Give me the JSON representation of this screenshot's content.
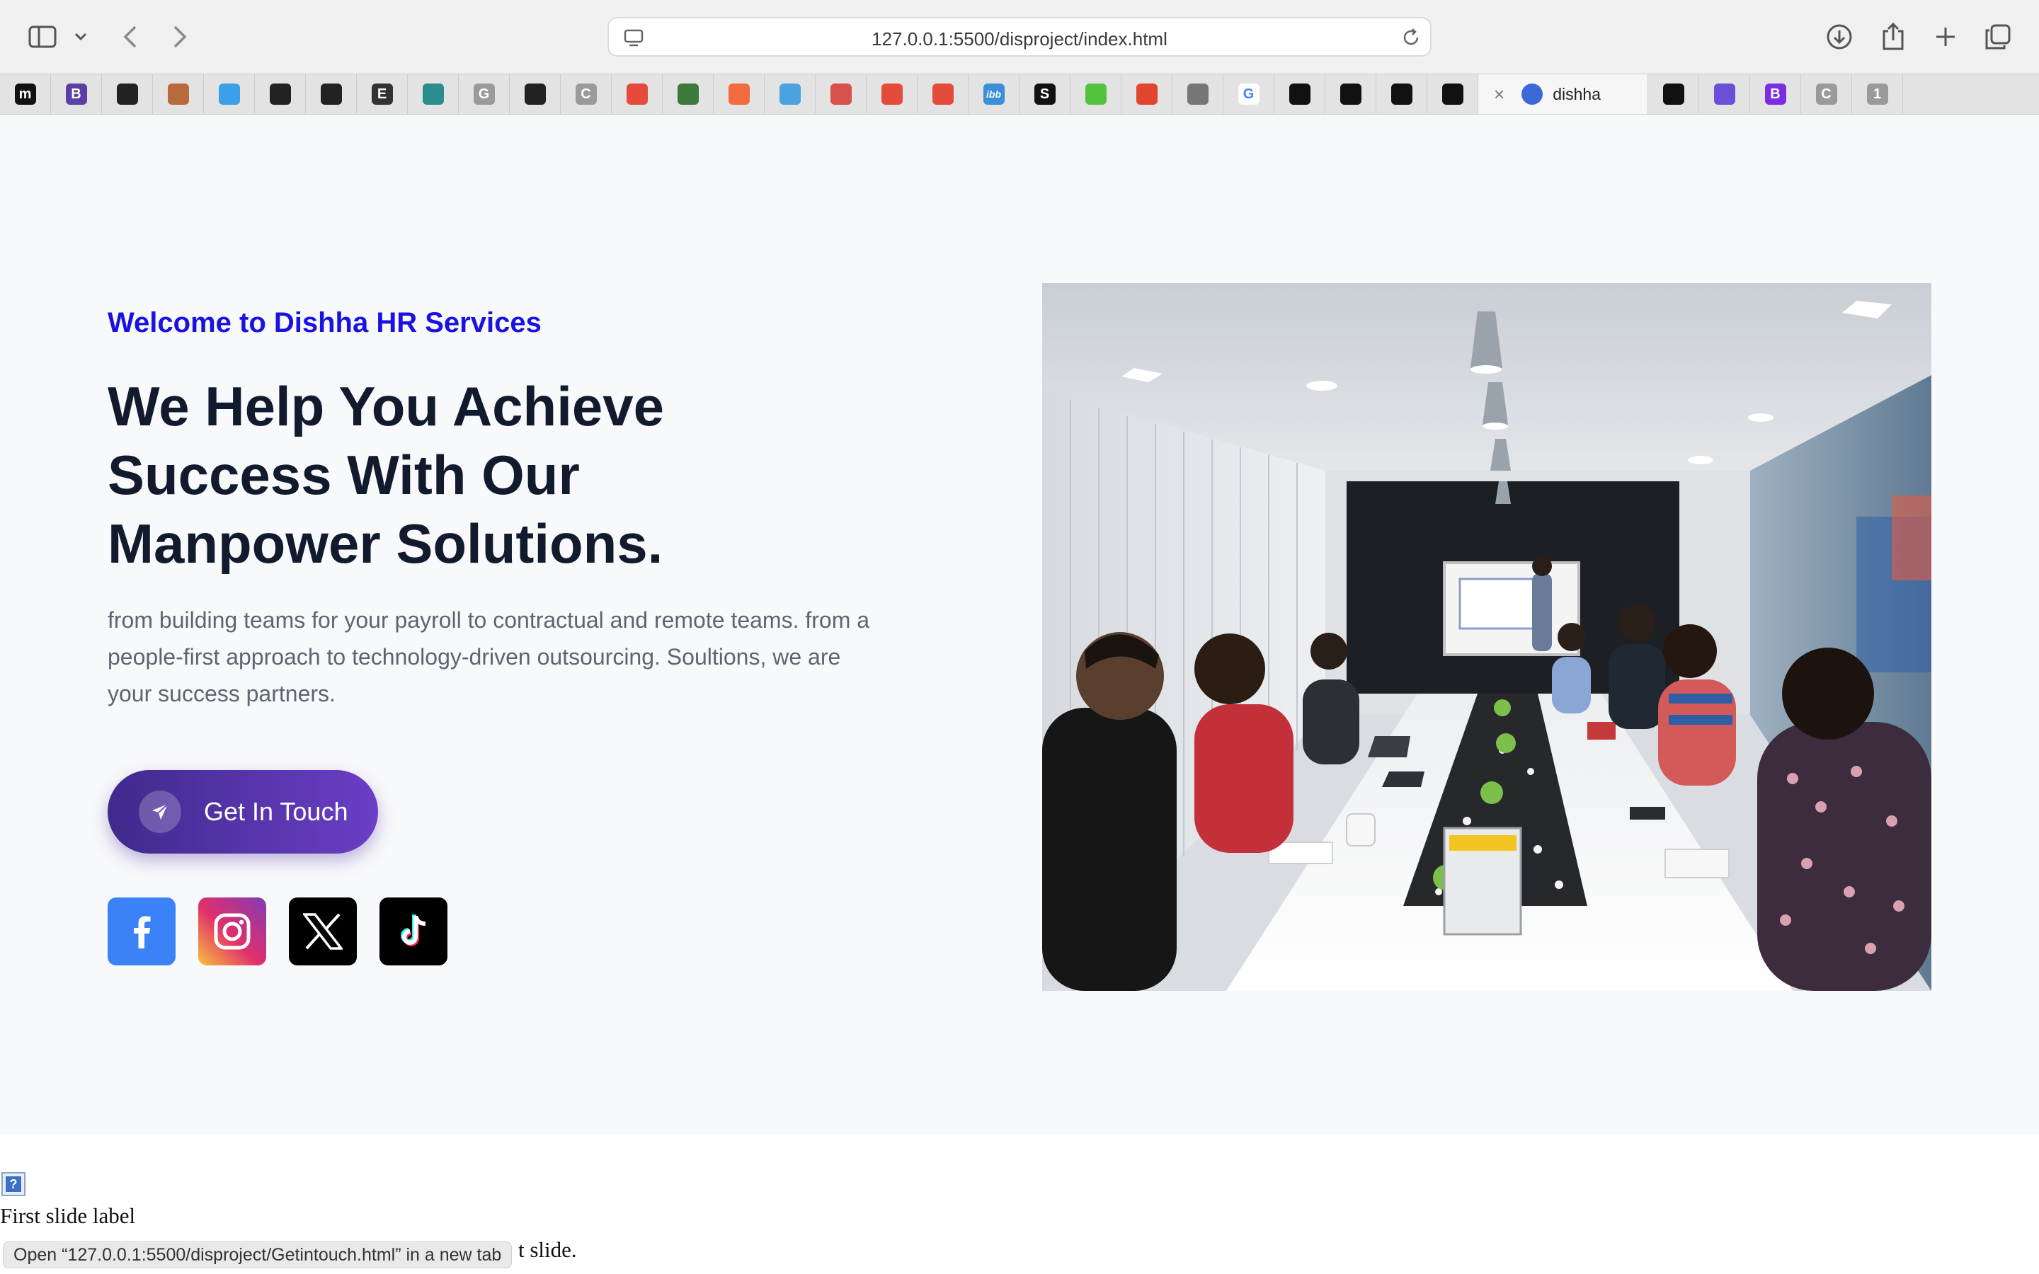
{
  "browser": {
    "url": "127.0.0.1:5500/disproject/index.html",
    "active_tab_title": "dishha",
    "tabs": [
      {
        "icon": "medium-favicon",
        "letter": "m",
        "color": "#111111"
      },
      {
        "icon": "bootstrap-favicon",
        "letter": "B",
        "color": "#5b3fa6"
      },
      {
        "icon": "github-favicon",
        "letter": "",
        "color": "#222222"
      },
      {
        "icon": "profile-favicon",
        "letter": "",
        "color": "#b86a3c"
      },
      {
        "icon": "bird-favicon",
        "letter": "",
        "color": "#3aa0e8"
      },
      {
        "icon": "github-favicon",
        "letter": "",
        "color": "#222222"
      },
      {
        "icon": "codepen-favicon",
        "letter": "",
        "color": "#222222"
      },
      {
        "icon": "elementor-favicon",
        "letter": "E",
        "color": "#333333"
      },
      {
        "icon": "refresh-favicon",
        "letter": "",
        "color": "#2d8c8c"
      },
      {
        "icon": "g-favicon",
        "letter": "G",
        "color": "#9a9a9a"
      },
      {
        "icon": "codepen-favicon",
        "letter": "",
        "color": "#222222"
      },
      {
        "icon": "c-favicon",
        "letter": "C",
        "color": "#9a9a9a"
      },
      {
        "icon": "chrome-favicon",
        "letter": "",
        "color": "#e44b3a"
      },
      {
        "icon": "image-favicon",
        "letter": "",
        "color": "#3b7a3b"
      },
      {
        "icon": "hubspot-favicon",
        "letter": "",
        "color": "#f26a3d"
      },
      {
        "icon": "cloud-favicon",
        "letter": "",
        "color": "#4aa3df"
      },
      {
        "icon": "circles-favicon",
        "letter": "",
        "color": "#d8504a"
      },
      {
        "icon": "chrome-favicon",
        "letter": "",
        "color": "#e44b3a"
      },
      {
        "icon": "chrome-favicon",
        "letter": "",
        "color": "#e44b3a"
      },
      {
        "icon": "ibb-favicon",
        "letter": "ibb",
        "color": "#3a8fd6"
      },
      {
        "icon": "s-favicon",
        "letter": "S",
        "color": "#111111"
      },
      {
        "icon": "lightning-favicon",
        "letter": "",
        "color": "#55c23e"
      },
      {
        "icon": "shape-favicon",
        "letter": "",
        "color": "#e2452e"
      },
      {
        "icon": "grid-favicon",
        "letter": "",
        "color": "#777777"
      },
      {
        "icon": "google-favicon",
        "letter": "G",
        "color": "#ffffff"
      },
      {
        "icon": "bowtie-favicon",
        "letter": "",
        "color": "#111111"
      },
      {
        "icon": "bowtie-favicon",
        "letter": "",
        "color": "#111111"
      },
      {
        "icon": "bowtie-favicon",
        "letter": "",
        "color": "#111111"
      },
      {
        "icon": "bowtie-favicon",
        "letter": "",
        "color": "#111111"
      },
      {
        "icon": "openai-favicon",
        "letter": "",
        "color": "#111111"
      },
      {
        "icon": "h-favicon",
        "letter": "",
        "color": "#6b4fd8"
      },
      {
        "icon": "bootstrap-favicon",
        "letter": "B",
        "color": "#7b2ee0"
      },
      {
        "icon": "c-favicon",
        "letter": "C",
        "color": "#9a9a9a"
      },
      {
        "icon": "one-favicon",
        "letter": "1",
        "color": "#9a9a9a"
      }
    ]
  },
  "hero": {
    "kicker": "Welcome to Dishha HR Services",
    "headline_lines": [
      "We Help You Achieve",
      "Success With Our",
      "Manpower Solutions."
    ],
    "lead_lines": [
      "from building teams for your payroll to contractual and remote teams. from a",
      "people-first approach to technology-driven outsourcing. Soultions, we are",
      "your success partners."
    ],
    "cta_label": "Get In Touch",
    "socials": [
      "facebook-icon",
      "instagram-icon",
      "x-icon",
      "tiktok-icon"
    ]
  },
  "carousel": {
    "slide_label": "First slide label",
    "slide_desc_visible": "t slide."
  },
  "status_bar": {
    "text": "Open “127.0.0.1:5500/disproject/Getintouch.html” in a new tab"
  }
}
